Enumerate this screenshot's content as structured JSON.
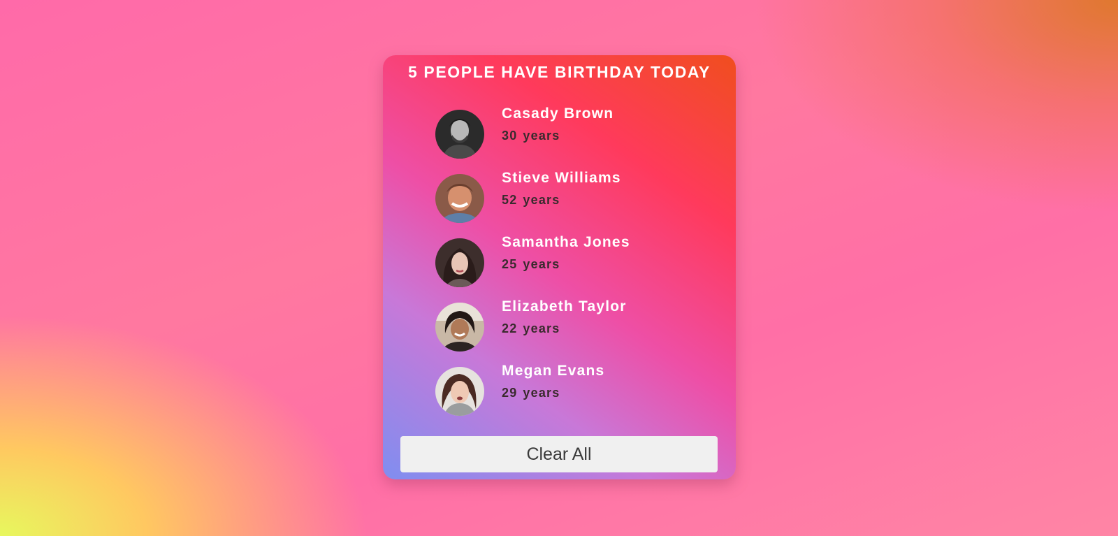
{
  "card": {
    "title": "5 PEOPLE HAVE BIRTHDAY TODAY",
    "people": [
      {
        "name": "Casady Brown",
        "age": "30",
        "unit": "years"
      },
      {
        "name": "Stieve Williams",
        "age": "52",
        "unit": "years"
      },
      {
        "name": "Samantha Jones",
        "age": "25",
        "unit": "years"
      },
      {
        "name": "Elizabeth Taylor",
        "age": "22",
        "unit": "years"
      },
      {
        "name": "Megan Evans",
        "age": "29",
        "unit": "years"
      }
    ],
    "clear_label": "Clear All"
  },
  "colors": {
    "card_gradient": [
      "#f04e1e",
      "#ff3a5c",
      "#ee4fa6",
      "#c878d8",
      "#7f8ef0"
    ],
    "button_bg": "#f0f0f0",
    "name_text": "#ffffff",
    "age_text": "#3a2a2e"
  },
  "icons": [
    "avatar-casady-brown",
    "avatar-stieve-williams",
    "avatar-samantha-jones",
    "avatar-elizabeth-taylor",
    "avatar-megan-evans"
  ]
}
